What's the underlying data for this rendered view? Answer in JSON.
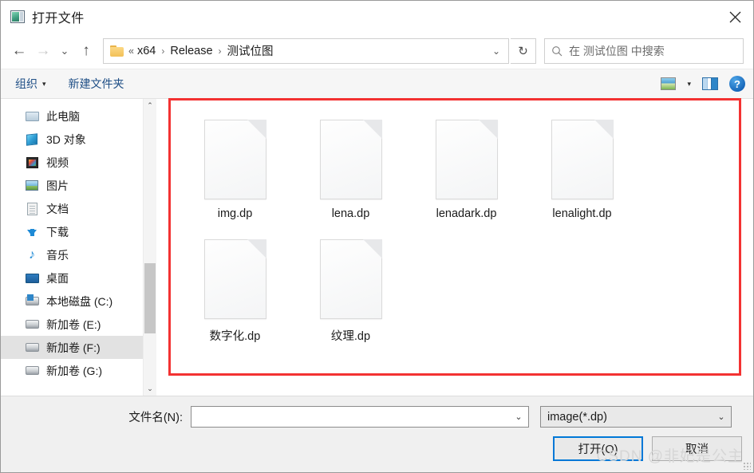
{
  "window": {
    "title": "打开文件",
    "app_icon": "image-file-icon",
    "close_label": "✕"
  },
  "nav": {
    "back": "←",
    "forward": "→",
    "recent": "⌄",
    "up": "↑",
    "refresh": "↻"
  },
  "address": {
    "folder_icon": "folder-icon",
    "leading": "«",
    "crumbs": [
      "x64",
      "Release",
      "测试位图"
    ],
    "separator": "›",
    "dropdown": "⌄"
  },
  "search": {
    "icon": "search-icon",
    "placeholder": "在 测试位图 中搜索",
    "value": ""
  },
  "toolbar": {
    "organize_label": "组织",
    "organize_caret": "▾",
    "new_folder_label": "新建文件夹",
    "view_icon": "picture-view-icon",
    "view_caret": "▾",
    "preview_pane_icon": "preview-pane-icon",
    "help_icon": "?"
  },
  "sidebar": {
    "scroll_up": "⌃",
    "scroll_down": "⌄",
    "items": [
      {
        "label": "此电脑",
        "icon": "pc-icon",
        "selected": false
      },
      {
        "label": "3D 对象",
        "icon": "3d-objects-icon",
        "selected": false
      },
      {
        "label": "视频",
        "icon": "videos-icon",
        "selected": false
      },
      {
        "label": "图片",
        "icon": "pictures-icon",
        "selected": false
      },
      {
        "label": "文档",
        "icon": "documents-icon",
        "selected": false
      },
      {
        "label": "下载",
        "icon": "downloads-icon",
        "selected": false
      },
      {
        "label": "音乐",
        "icon": "music-icon",
        "selected": false
      },
      {
        "label": "桌面",
        "icon": "desktop-icon",
        "selected": false
      },
      {
        "label": "本地磁盘 (C:)",
        "icon": "windows-drive-icon",
        "selected": false
      },
      {
        "label": "新加卷 (E:)",
        "icon": "drive-icon",
        "selected": false
      },
      {
        "label": "新加卷 (F:)",
        "icon": "drive-icon",
        "selected": true
      },
      {
        "label": "新加卷 (G:)",
        "icon": "drive-icon",
        "selected": false
      }
    ]
  },
  "files": {
    "items": [
      {
        "name": "img.dp",
        "icon": "blank-document-icon"
      },
      {
        "name": "lena.dp",
        "icon": "blank-document-icon"
      },
      {
        "name": "lenadark.dp",
        "icon": "blank-document-icon"
      },
      {
        "name": "lenalight.dp",
        "icon": "blank-document-icon"
      },
      {
        "name": "数字化.dp",
        "icon": "blank-document-icon"
      },
      {
        "name": "纹理.dp",
        "icon": "blank-document-icon"
      }
    ]
  },
  "annotation": {
    "color": "#f33232",
    "shape": "rectangle"
  },
  "footer": {
    "filename_label": "文件名(N):",
    "filename_value": "",
    "filename_placeholder": "",
    "filename_caret": "⌄",
    "filetype_value": "image(*.dp)",
    "filetype_caret": "⌄",
    "open_button": "打开(O)",
    "cancel_button": "取消",
    "watermark": "CSDN @非妃是公主"
  }
}
